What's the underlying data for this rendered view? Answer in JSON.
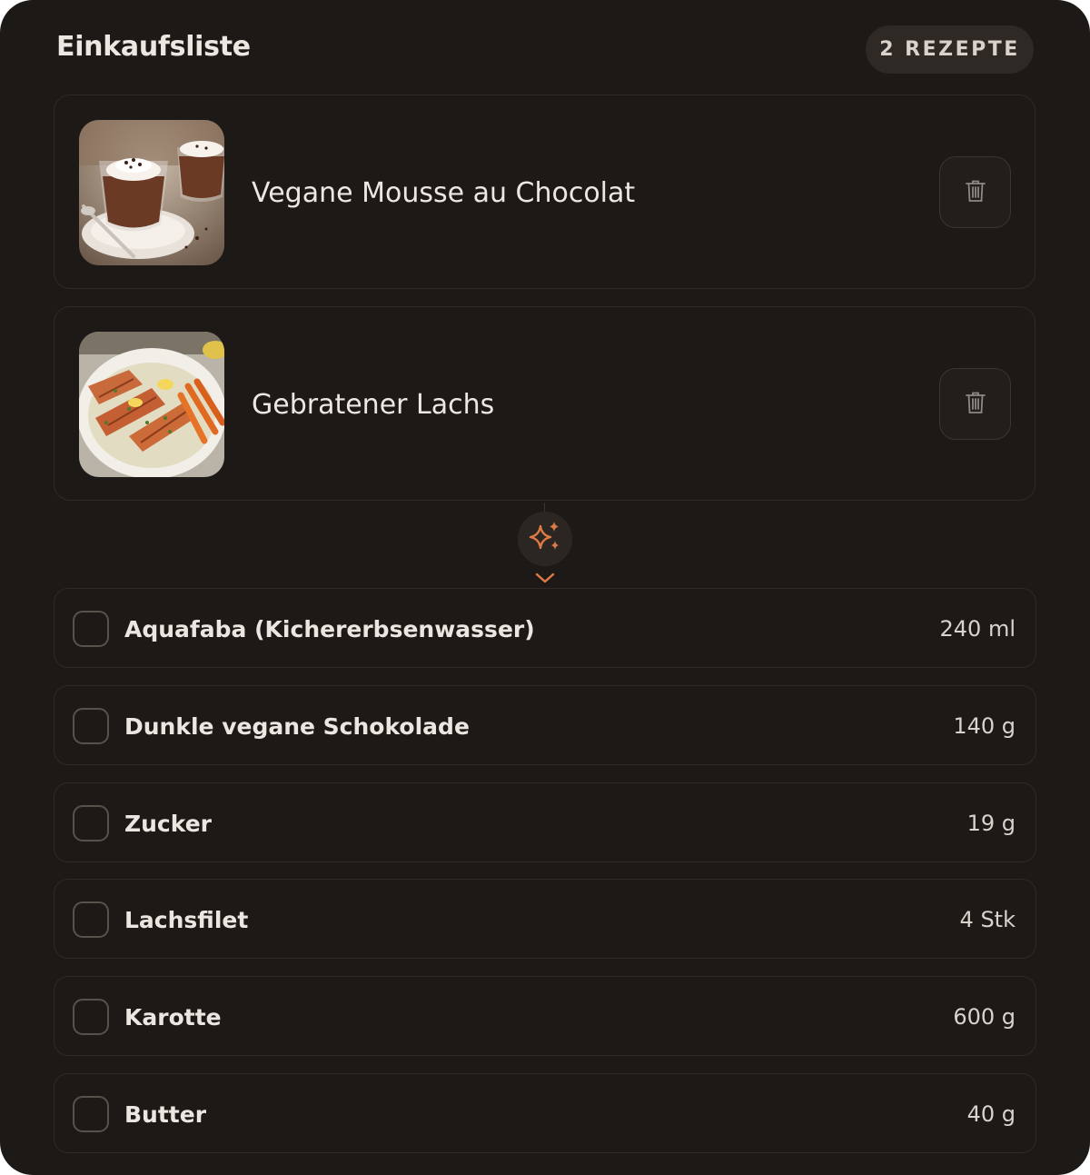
{
  "header": {
    "title": "Einkaufsliste",
    "recipe_count_badge": "2 REZEPTE"
  },
  "recipes": [
    {
      "name": "Vegane Mousse au Chocolat",
      "image": "chocolate-mousse-photo",
      "delete_icon": "trash-icon"
    },
    {
      "name": "Gebratener Lachs",
      "image": "fried-salmon-photo",
      "delete_icon": "trash-icon"
    }
  ],
  "divider": {
    "icon": "sparkles-icon",
    "chevron_icon": "chevron-down-icon"
  },
  "ingredients": [
    {
      "name": "Aquafaba (Kichererbsenwasser)",
      "quantity": "240 ml",
      "checked": false
    },
    {
      "name": "Dunkle vegane Schokolade",
      "quantity": "140 g",
      "checked": false
    },
    {
      "name": "Zucker",
      "quantity": "19 g",
      "checked": false
    },
    {
      "name": "Lachsfilet",
      "quantity": "4 Stk",
      "checked": false
    },
    {
      "name": "Karotte",
      "quantity": "600 g",
      "checked": false
    },
    {
      "name": "Butter",
      "quantity": "40 g",
      "checked": false
    }
  ],
  "colors": {
    "background": "#1c1917",
    "card_border": "#2f2a27",
    "accent": "#e07a45",
    "text": "#ece7e1"
  }
}
